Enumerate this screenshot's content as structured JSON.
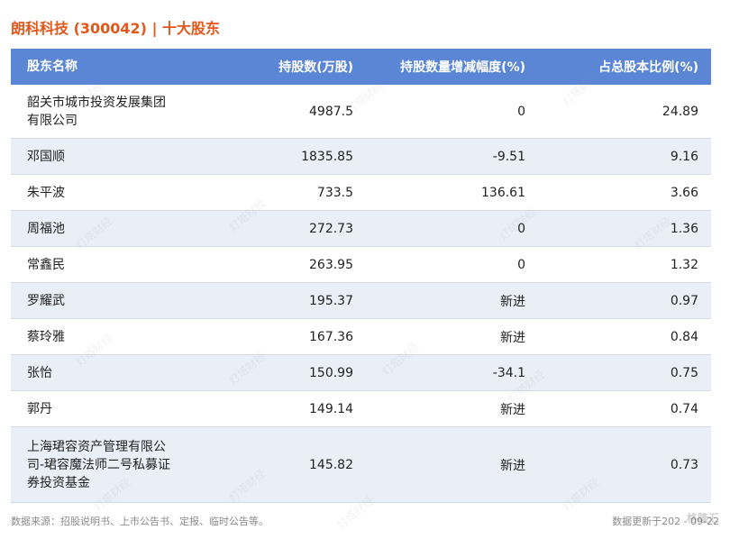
{
  "title": "朗科科技 (300042) | 十大股东",
  "columns": [
    "股东名称",
    "持股数(万股)",
    "持股数量增减幅度(%)",
    "占总股本比例(%)"
  ],
  "rows": [
    {
      "name": "韶关市城市投资发展集团\n有限公司",
      "shares": "4987.5",
      "change": "0",
      "ratio": "24.89"
    },
    {
      "name": "邓国顺",
      "shares": "1835.85",
      "change": "-9.51",
      "ratio": "9.16"
    },
    {
      "name": "朱平波",
      "shares": "733.5",
      "change": "136.61",
      "ratio": "3.66"
    },
    {
      "name": "周福池",
      "shares": "272.73",
      "change": "0",
      "ratio": "1.36"
    },
    {
      "name": "常鑫民",
      "shares": "263.95",
      "change": "0",
      "ratio": "1.32"
    },
    {
      "name": "罗耀武",
      "shares": "195.37",
      "change": "新进",
      "ratio": "0.97"
    },
    {
      "name": "蔡玲雅",
      "shares": "167.36",
      "change": "新进",
      "ratio": "0.84"
    },
    {
      "name": "张怡",
      "shares": "150.99",
      "change": "-34.1",
      "ratio": "0.75"
    },
    {
      "name": "郭丹",
      "shares": "149.14",
      "change": "新进",
      "ratio": "0.74"
    },
    {
      "name": "上海珺容资产管理有限公\n司-珺容魔法师二号私募证\n券投资基金",
      "shares": "145.82",
      "change": "新进",
      "ratio": "0.73"
    }
  ],
  "footer": {
    "source": "数据来源：招股说明书、上市公告书、定报、临时公告等。",
    "updated": "数据更新于202 - 09-22"
  },
  "watermark": "灯塔财经",
  "logo": "格隆汇",
  "colors": {
    "title": "#e2571b",
    "header_bg": "#5b86d6",
    "row_alt": "#e9eef7"
  }
}
